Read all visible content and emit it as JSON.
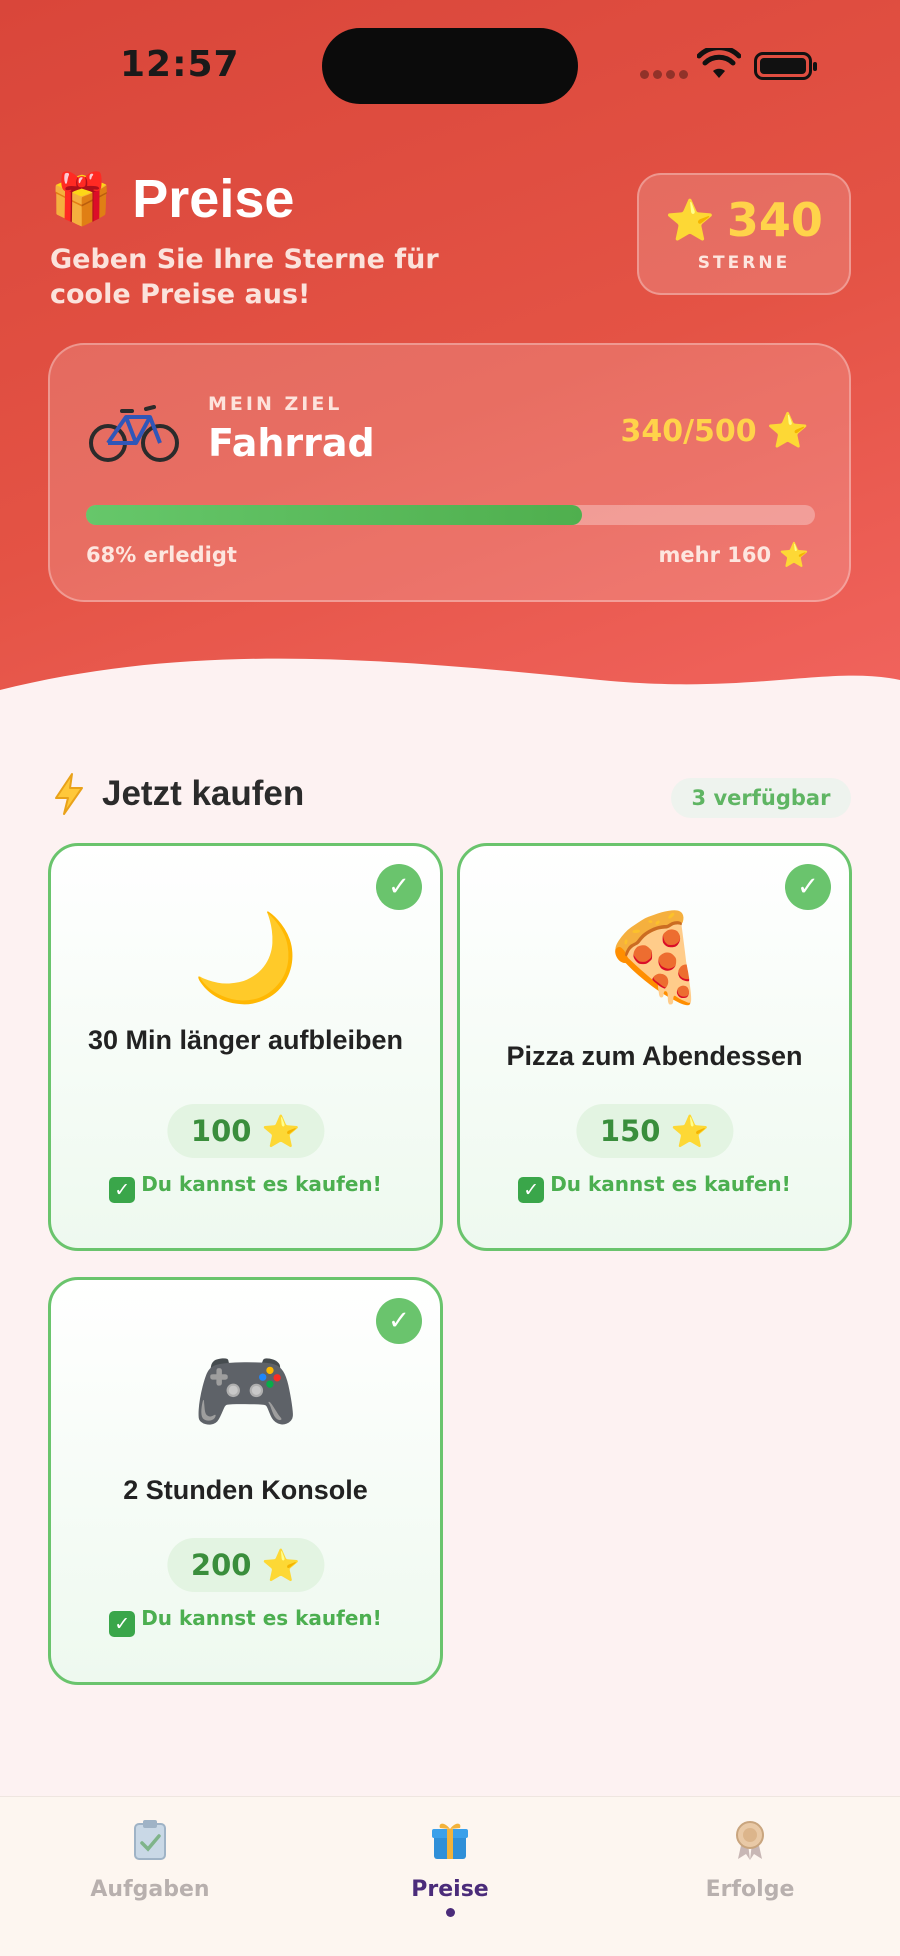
{
  "status_bar": {
    "time": "12:57"
  },
  "header": {
    "title": "Preise",
    "subtitle": "Geben Sie Ihre Sterne für coole Preise aus!",
    "stars_count": "340",
    "stars_label": "STERNE",
    "gift_icon": "🎁",
    "star_icon": "⭐"
  },
  "goal": {
    "label": "MEIN ZIEL",
    "name": "Fahrrad",
    "progress_text": "340/500",
    "progress_fraction": 0.68,
    "done_text": "68% erledigt",
    "more_text": "mehr 160",
    "icon": "bicycle-icon"
  },
  "section": {
    "title": "Jetzt kaufen",
    "available": "3 verfügbar",
    "icon": "lightning-icon"
  },
  "rewards": [
    {
      "emoji": "🌙",
      "title": "30 Min länger aufbleiben",
      "price": "100",
      "status": "Du kannst es kaufen!",
      "check": "✓",
      "status_box": "✓"
    },
    {
      "emoji": "🍕",
      "title": "Pizza zum Abendessen",
      "price": "150",
      "status": "Du kannst es kaufen!",
      "check": "✓",
      "status_box": "✓"
    },
    {
      "emoji": "🎮",
      "title": "2 Stunden Konsole",
      "price": "200",
      "status": "Du kannst es kaufen!",
      "check": "✓",
      "status_box": "✓"
    }
  ],
  "tabs": [
    {
      "label": "Aufgaben",
      "icon": "clipboard-icon",
      "active": false
    },
    {
      "label": "Preise",
      "icon": "gift-icon",
      "active": true
    },
    {
      "label": "Erfolge",
      "icon": "medal-icon",
      "active": false
    }
  ],
  "colors": {
    "header_red": "#e45345",
    "accent_green": "#6ac46d",
    "star_gold": "#ffd34a",
    "active_tab": "#4b2c7a"
  }
}
